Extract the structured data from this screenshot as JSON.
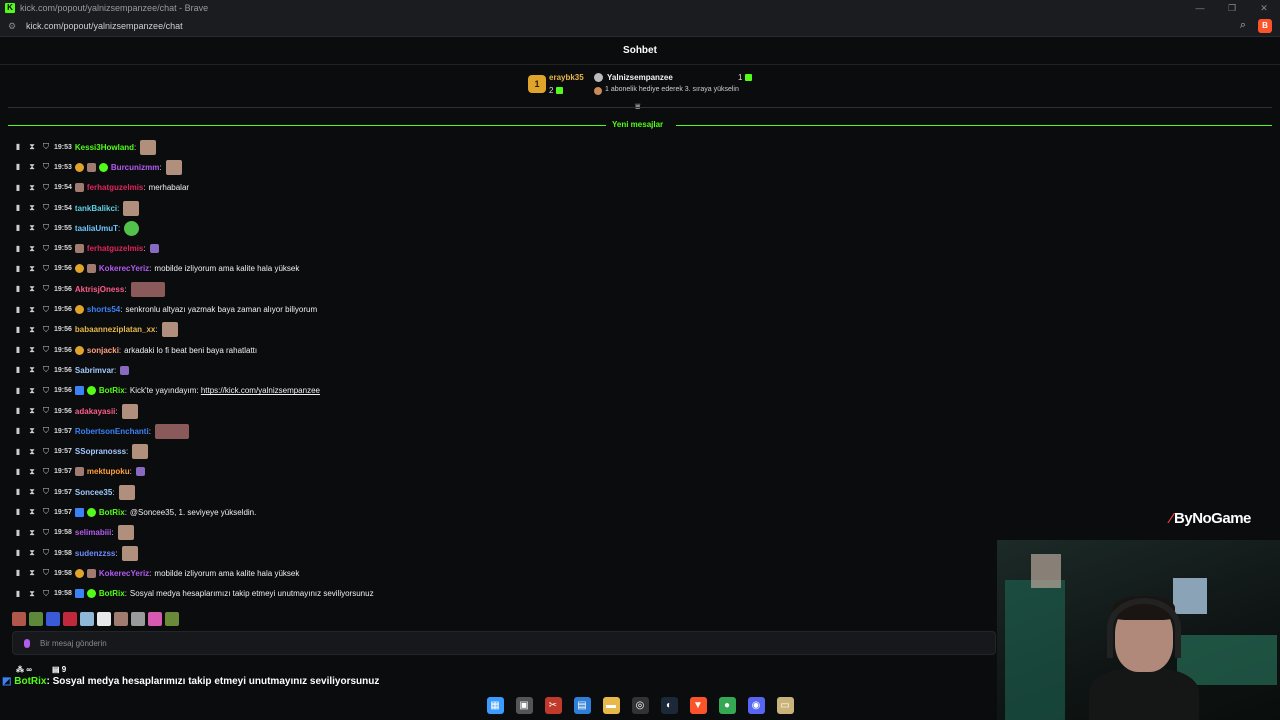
{
  "window": {
    "title": "kick.com/popout/yalnizsempanzee/chat - Brave",
    "url": "kick.com/popout/yalnizsempanzee/chat"
  },
  "chat": {
    "header_title": "Sohbet",
    "leaderboard": {
      "rank": "1",
      "top_user": "eraybk35",
      "top_user_count": "2",
      "streamer": "Yalnizsempanzee",
      "streamer_count": "1",
      "hint": "1 abonelik hediye ederek 3. sıraya yükselin"
    },
    "new_messages_label": "Yeni mesajlar",
    "messages": [
      {
        "time": "19:53",
        "badges": [],
        "user": "Kessi3Howland",
        "color": "#53fc18",
        "text": "",
        "emotes": [
          "single"
        ]
      },
      {
        "time": "19:53",
        "badges": [
          "gold",
          "avatar",
          "green"
        ],
        "user": "Burcunizmm",
        "color": "#b35cf0",
        "text": "",
        "emotes": [
          "single"
        ]
      },
      {
        "time": "19:54",
        "badges": [
          "avatar"
        ],
        "user": "ferhatguzelmis",
        "color": "#e0245e",
        "text": "merhabalar",
        "emotes": []
      },
      {
        "time": "19:54",
        "badges": [],
        "user": "tankBalikci",
        "color": "#5fd0e6",
        "text": "",
        "emotes": [
          "single"
        ]
      },
      {
        "time": "19:55",
        "badges": [],
        "user": "taaliaUmuT",
        "color": "#6ec6ff",
        "text": "",
        "emotes": [
          "round"
        ]
      },
      {
        "time": "19:55",
        "badges": [
          "avatar"
        ],
        "user": "ferhatguzelmis",
        "color": "#e0245e",
        "text": "",
        "emotes": [
          "tiny"
        ]
      },
      {
        "time": "19:56",
        "badges": [
          "gold",
          "avatar"
        ],
        "user": "KokerecYeriz",
        "color": "#b35cf0",
        "text": "mobilde izliyorum ama kalite hala yüksek",
        "emotes": []
      },
      {
        "time": "19:56",
        "badges": [],
        "user": "AktrisjOness",
        "color": "#ff5c8a",
        "text": "",
        "emotes": [
          "wide"
        ]
      },
      {
        "time": "19:56",
        "badges": [
          "gold"
        ],
        "user": "shorts54",
        "color": "#3b82f6",
        "text": "senkronlu altyazı yazmak baya zaman alıyor biliyorum",
        "emotes": []
      },
      {
        "time": "19:56",
        "badges": [],
        "user": "babaanneziplatan_xx",
        "color": "#e8b84a",
        "text": "",
        "emotes": [
          "single"
        ]
      },
      {
        "time": "19:56",
        "badges": [
          "gold"
        ],
        "user": "sonjacki",
        "color": "#ff9e80",
        "text": "arkadaki lo fi beat beni baya rahatlattı",
        "emotes": []
      },
      {
        "time": "19:56",
        "badges": [],
        "user": "Sabrimvar",
        "color": "#a3c9ff",
        "text": "",
        "emotes": [
          "tiny"
        ]
      },
      {
        "time": "19:56",
        "badges": [
          "blue",
          "green"
        ],
        "user": "BotRix",
        "color": "#53fc18",
        "text": "Kick'te yayındayım: ",
        "link": "https://kick.com/yalnizsempanzee",
        "emotes": []
      },
      {
        "time": "19:56",
        "badges": [],
        "user": "adakayasii",
        "color": "#ff5c8a",
        "text": "",
        "emotes": [
          "single"
        ]
      },
      {
        "time": "19:57",
        "badges": [],
        "user": "RobertsonEnchanti",
        "color": "#3b82f6",
        "text": "",
        "emotes": [
          "wide"
        ]
      },
      {
        "time": "19:57",
        "badges": [],
        "user": "SSopranosss",
        "color": "#a3c9ff",
        "text": "",
        "emotes": [
          "single"
        ]
      },
      {
        "time": "19:57",
        "badges": [
          "avatar"
        ],
        "user": "mektupoku",
        "color": "#ff9e3d",
        "text": "",
        "emotes": [
          "tiny"
        ]
      },
      {
        "time": "19:57",
        "badges": [],
        "user": "Soncee35",
        "color": "#a3c9ff",
        "text": "",
        "emotes": [
          "single"
        ]
      },
      {
        "time": "19:57",
        "badges": [
          "blue",
          "green"
        ],
        "user": "BotRix",
        "color": "#53fc18",
        "text": "@Soncee35, 1. seviyeye yükseldin.",
        "emotes": []
      },
      {
        "time": "19:58",
        "badges": [],
        "user": "selimabiii",
        "color": "#b35cf0",
        "text": "",
        "emotes": [
          "single"
        ]
      },
      {
        "time": "19:58",
        "badges": [],
        "user": "sudenzzss",
        "color": "#6e8bff",
        "text": "",
        "emotes": [
          "single"
        ]
      },
      {
        "time": "19:58",
        "badges": [
          "gold",
          "avatar"
        ],
        "user": "KokerecYeriz",
        "color": "#b35cf0",
        "text": "mobilde izliyorum ama kalite hala yüksek",
        "emotes": []
      },
      {
        "time": "19:58",
        "badges": [
          "blue",
          "green"
        ],
        "user": "BotRix",
        "color": "#53fc18",
        "text": "Sosyal medya hesaplarımızı takip etmeyi unutmayınız seviliyorsunuz",
        "emotes": []
      }
    ],
    "input_placeholder": "Bir mesaj gönderin"
  },
  "overlay": {
    "viewers_label": "∞",
    "gift_count": "9",
    "ticker_user": "BotRix",
    "ticker_text": ": Sosyal medya hesaplarımızı takip etmeyi unutmayınız seviliyorsunuz",
    "sponsor": "ByNoGame"
  },
  "taskbar": [
    {
      "name": "windows-start-icon",
      "color": "#3b9bff",
      "glyph": "▦"
    },
    {
      "name": "task-view-icon",
      "color": "#555",
      "glyph": "▣"
    },
    {
      "name": "snipping-tool-icon",
      "color": "#c0392b",
      "glyph": "✂"
    },
    {
      "name": "photos-icon",
      "color": "#2f7fd8",
      "glyph": "▤"
    },
    {
      "name": "file-explorer-icon",
      "color": "#e8b84a",
      "glyph": "▬"
    },
    {
      "name": "obs-icon",
      "color": "#333",
      "glyph": "◎"
    },
    {
      "name": "steam-icon",
      "color": "#1b2838",
      "glyph": "◐"
    },
    {
      "name": "brave-icon",
      "color": "#fb542b",
      "glyph": "▼"
    },
    {
      "name": "chrome-icon",
      "color": "#34a853",
      "glyph": "●"
    },
    {
      "name": "discord-icon",
      "color": "#5865f2",
      "glyph": "◉"
    },
    {
      "name": "notepad-icon",
      "color": "#c9b37a",
      "glyph": "▭"
    }
  ]
}
